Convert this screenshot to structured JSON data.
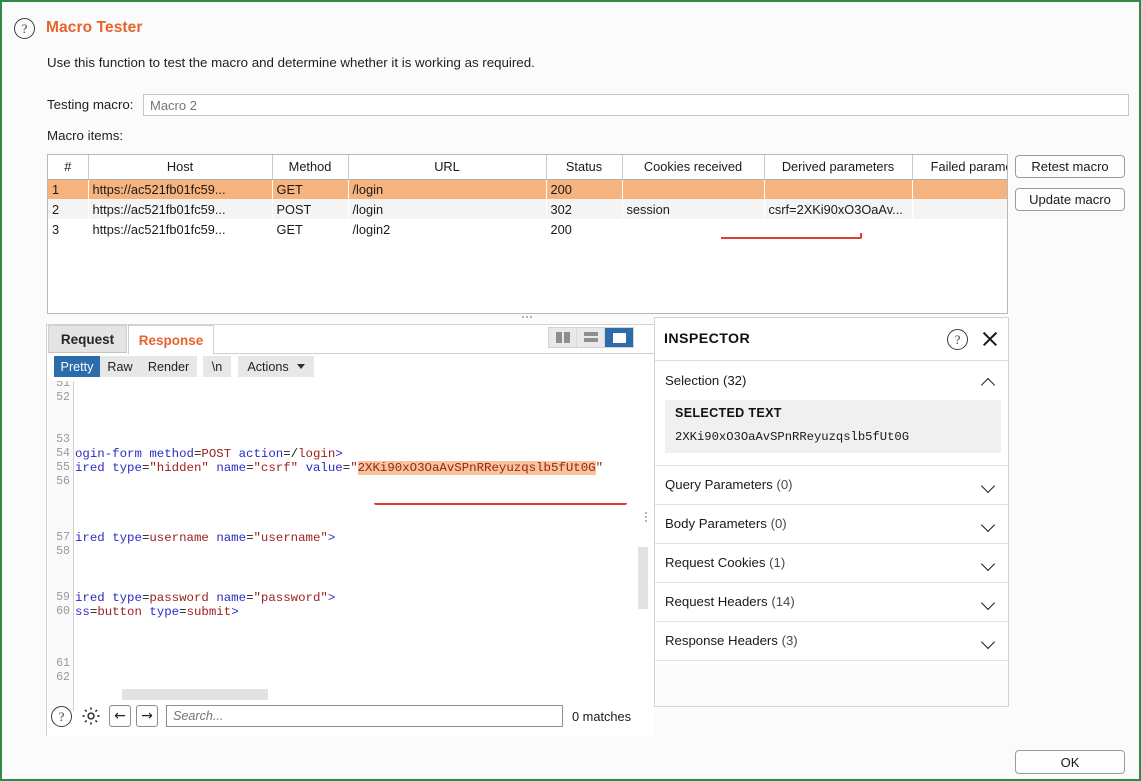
{
  "window": {
    "border_color": "#2e8b45",
    "accent_color": "#e8622c",
    "selected_row_color": "#f6b37d",
    "highlight_color": "#f8c49a",
    "annotation_color": "#e33b2e"
  },
  "header": {
    "title": "Macro Tester",
    "help_icon": "?",
    "description": "Use this function to test the macro and determine whether it is working as required."
  },
  "macro_row": {
    "label": "Testing macro:",
    "value": "Macro 2",
    "placeholder": "Macro 2"
  },
  "macro_items": {
    "label": "Macro items:",
    "columns": [
      "#",
      "Host",
      "Method",
      "URL",
      "Status",
      "Cookies received",
      "Derived parameters",
      "Failed parameters"
    ],
    "rows": [
      {
        "num": "1",
        "host": "https://ac521fb01fc59...",
        "method": "GET",
        "url": "/login",
        "status": "200",
        "cookies": "",
        "derived": "",
        "failed": "",
        "selected": true
      },
      {
        "num": "2",
        "host": "https://ac521fb01fc59...",
        "method": "POST",
        "url": "/login",
        "status": "302",
        "cookies": "session",
        "derived": "csrf=2XKi90xO3OaAv...",
        "failed": "",
        "selected": false
      },
      {
        "num": "3",
        "host": "https://ac521fb01fc59...",
        "method": "GET",
        "url": "/login2",
        "status": "200",
        "cookies": "",
        "derived": "",
        "failed": "",
        "selected": false
      }
    ]
  },
  "side_buttons": {
    "retest": "Retest macro",
    "update": "Update macro"
  },
  "footer": {
    "ok": "OK"
  },
  "editor": {
    "tabs": [
      {
        "label": "Request",
        "active": false
      },
      {
        "label": "Response",
        "active": true
      }
    ],
    "layout_toggles": [
      {
        "name": "split-vertical",
        "active": false
      },
      {
        "name": "split-horizontal",
        "active": false
      },
      {
        "name": "single-pane",
        "active": true
      }
    ],
    "view_buttons": [
      {
        "label": "Pretty",
        "active": true
      },
      {
        "label": "Raw",
        "active": false
      },
      {
        "label": "Render",
        "active": false
      },
      {
        "label": "\\n",
        "active": false
      }
    ],
    "actions_label": "Actions",
    "line_numbers": [
      "51",
      "52",
      "53",
      "54",
      "55",
      "56",
      "57",
      "58",
      "59",
      "60",
      "61",
      "62"
    ],
    "code_lines": [
      {
        "n": "51",
        "text": ""
      },
      {
        "n": "52",
        "text": ""
      },
      {
        "n": "53",
        "text": ""
      },
      {
        "n": "54",
        "text": "ogin-form method=POST action=/login>"
      },
      {
        "n": "55",
        "text": "ired type=\"hidden\" name=\"csrf\" value=\"2XKi90xO3OaAvSPnRReyuzqslb5fUt0G\""
      },
      {
        "n": "56",
        "text": ""
      },
      {
        "n": "57",
        "text": "ired type=username name=\"username\">"
      },
      {
        "n": "58",
        "text": ""
      },
      {
        "n": "59",
        "text": "ired type=password name=\"password\">"
      },
      {
        "n": "60",
        "text": "ss=button type=submit>"
      },
      {
        "n": "61",
        "text": ""
      },
      {
        "n": "62",
        "text": ""
      }
    ],
    "selected_token": "2XKi90xO3OaAvSPnRReyuzqslb5fUt0G"
  },
  "search_bar": {
    "help_icon": "?",
    "settings_icon": "gear-icon",
    "prev_icon": "←",
    "next_icon": "→",
    "placeholder": "Search...",
    "value": "",
    "matches": "0 matches"
  },
  "inspector": {
    "title": "INSPECTOR",
    "help_icon": "?",
    "close_icon": "×",
    "selection": {
      "label": "Selection",
      "count": "(32)",
      "box_title": "SELECTED TEXT",
      "box_value": "2XKi90xO3OaAvSPnRReyuzqslb5fUt0G",
      "expanded": true
    },
    "sections": [
      {
        "label": "Query Parameters",
        "count": "(0)",
        "expanded": false
      },
      {
        "label": "Body Parameters",
        "count": "(0)",
        "expanded": false
      },
      {
        "label": "Request Cookies",
        "count": "(1)",
        "expanded": false
      },
      {
        "label": "Request Headers",
        "count": "(14)",
        "expanded": false
      },
      {
        "label": "Response Headers",
        "count": "(3)",
        "expanded": false
      }
    ]
  }
}
